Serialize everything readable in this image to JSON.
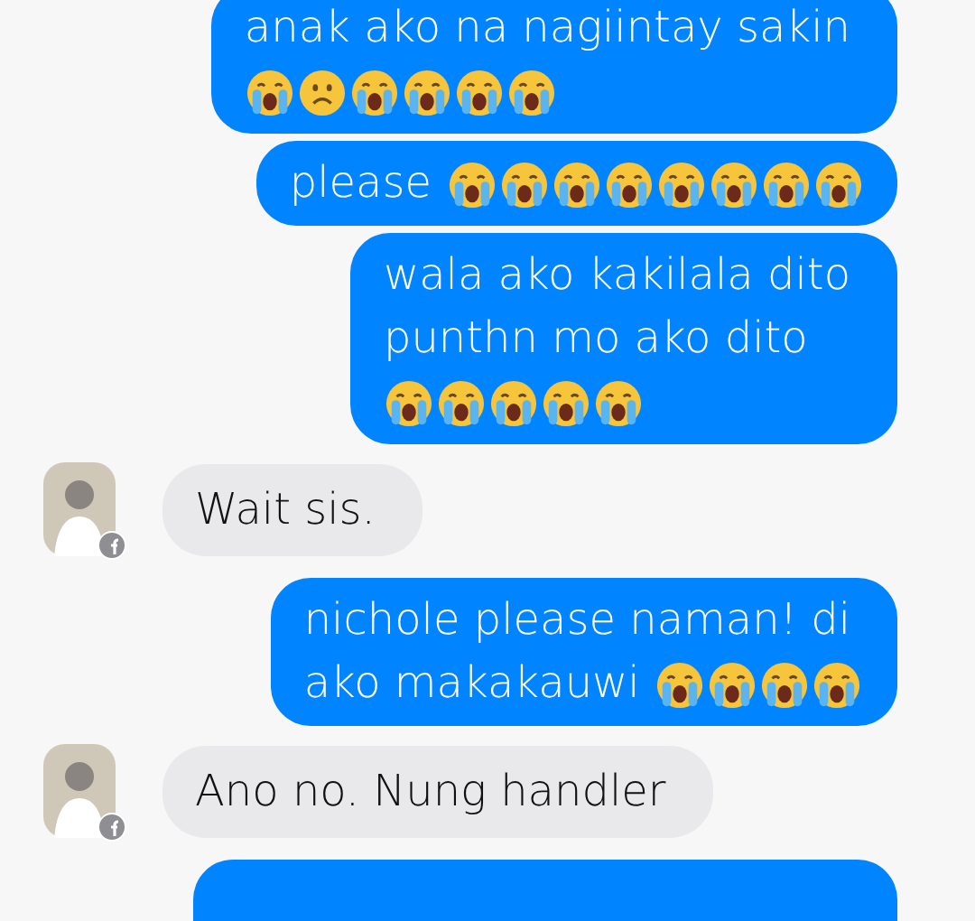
{
  "messages": [
    {
      "kind": "sent",
      "lines": [
        {
          "text": "anak ako na nagiintay sakin"
        },
        {
          "emojis": [
            {
              "kind": "crying"
            },
            {
              "kind": "frowning"
            },
            {
              "kind": "crying"
            },
            {
              "kind": "crying"
            },
            {
              "kind": "crying"
            },
            {
              "kind": "crying"
            }
          ]
        }
      ]
    },
    {
      "kind": "sent",
      "lines": [
        {
          "text": "please",
          "emojis": [
            {
              "kind": "crying"
            },
            {
              "kind": "crying"
            },
            {
              "kind": "crying"
            },
            {
              "kind": "crying"
            },
            {
              "kind": "crying"
            },
            {
              "kind": "crying"
            },
            {
              "kind": "crying"
            },
            {
              "kind": "crying"
            }
          ]
        }
      ]
    },
    {
      "kind": "sent",
      "lines": [
        {
          "text": "wala ako kakilala dito"
        },
        {
          "text": "punthn mo ako dito"
        },
        {
          "emojis": [
            {
              "kind": "crying"
            },
            {
              "kind": "crying"
            },
            {
              "kind": "crying"
            },
            {
              "kind": "crying"
            },
            {
              "kind": "crying"
            }
          ]
        }
      ]
    },
    {
      "kind": "received",
      "lines": [
        {
          "text": "Wait sis."
        }
      ]
    },
    {
      "kind": "sent",
      "lines": [
        {
          "text": "nichole please naman! di"
        },
        {
          "text": "ako makakauwi",
          "emojis": [
            {
              "kind": "crying"
            },
            {
              "kind": "crying"
            },
            {
              "kind": "crying"
            },
            {
              "kind": "crying"
            }
          ]
        }
      ]
    },
    {
      "kind": "received",
      "lines": [
        {
          "text": "Ano no. Nung handler"
        }
      ]
    },
    {
      "kind": "sent"
    }
  ]
}
